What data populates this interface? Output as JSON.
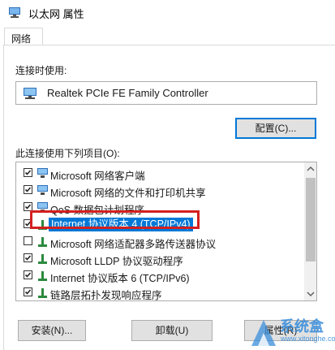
{
  "window": {
    "title": "以太网 属性"
  },
  "tabs": [
    {
      "label": "网络"
    }
  ],
  "connect_using": {
    "label": "连接时使用:",
    "adapter": "Realtek PCIe FE Family Controller",
    "configure_button": "配置(C)..."
  },
  "items_section": {
    "label": "此连接使用下列项目(O):",
    "items": [
      {
        "label": "Microsoft 网络客户端",
        "checked": true,
        "icon": "network-client-icon"
      },
      {
        "label": "Microsoft 网络的文件和打印机共享",
        "checked": true,
        "icon": "file-share-icon"
      },
      {
        "label": "QoS 数据包计划程序",
        "checked": true,
        "icon": "qos-icon"
      },
      {
        "label": "Internet 协议版本 4 (TCP/IPv4)",
        "checked": true,
        "icon": "protocol-icon",
        "selected": true
      },
      {
        "label": "Microsoft 网络适配器多路传送器协议",
        "checked": false,
        "icon": "protocol-icon"
      },
      {
        "label": "Microsoft LLDP 协议驱动程序",
        "checked": true,
        "icon": "protocol-icon"
      },
      {
        "label": "Internet 协议版本 6 (TCP/IPv6)",
        "checked": true,
        "icon": "protocol-icon"
      },
      {
        "label": "链路层拓扑发现响应程序",
        "checked": true,
        "icon": "protocol-icon"
      }
    ]
  },
  "buttons": {
    "install": "安装(N)...",
    "uninstall": "卸载(U)",
    "properties": "属性(R)"
  },
  "watermark": {
    "text": "系统盒",
    "url": "www.xitonghe.com"
  },
  "colors": {
    "selection": "#0078d7",
    "highlight_border": "#d32020",
    "default_button_border": "#0078d7"
  }
}
